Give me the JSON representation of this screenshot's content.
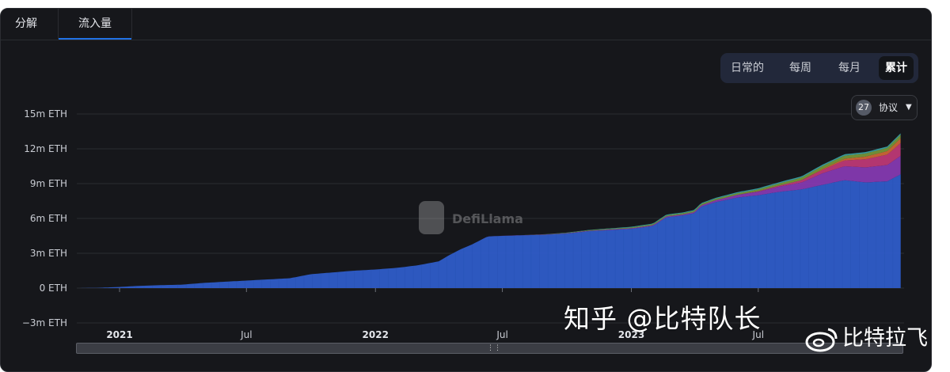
{
  "tabs": [
    {
      "label": "分解",
      "active": false
    },
    {
      "label": "流入量",
      "active": true
    }
  ],
  "period_toggle": {
    "options": [
      "日常的",
      "每周",
      "每月",
      "累计"
    ],
    "selected": "累计"
  },
  "protocol_filter": {
    "count": "27",
    "label": "协议"
  },
  "logo_watermark": "DefiLlama",
  "overlay_watermarks": {
    "zhihu": "知乎 @比特队长",
    "weibo": "比特拉飞"
  },
  "colors": {
    "primary_series": "#2e5cc8",
    "accent_tab": "#2172e5",
    "background": "#16171b"
  },
  "chart_data": {
    "type": "area",
    "title": "",
    "xlabel": "",
    "ylabel": "",
    "y_unit": "m ETH",
    "ylim": [
      -3,
      15
    ],
    "y_ticks": [
      -3,
      0,
      3,
      6,
      9,
      12,
      15
    ],
    "y_tick_labels": [
      "−3m ETH",
      "0 ETH",
      "3m ETH",
      "6m ETH",
      "9m ETH",
      "12m ETH",
      "15m ETH"
    ],
    "xlim": [
      "2020-11-01",
      "2024-01-25"
    ],
    "x_ticks": [
      {
        "date": "2021-01-01",
        "label": "2021",
        "bold": true
      },
      {
        "date": "2021-07-01",
        "label": "Jul",
        "bold": false
      },
      {
        "date": "2022-01-01",
        "label": "2022",
        "bold": true
      },
      {
        "date": "2022-07-01",
        "label": "Jul",
        "bold": false
      },
      {
        "date": "2023-01-01",
        "label": "2023",
        "bold": true
      },
      {
        "date": "2023-07-01",
        "label": "Jul",
        "bold": false
      }
    ],
    "grid": true,
    "legend": "none",
    "stacked": true,
    "series": [
      {
        "color": "#2e5cc8",
        "points": [
          [
            "2020-11-01",
            0
          ],
          [
            "2020-12-01",
            0.02
          ],
          [
            "2021-01-01",
            0.1
          ],
          [
            "2021-02-01",
            0.2
          ],
          [
            "2021-03-01",
            0.25
          ],
          [
            "2021-04-01",
            0.3
          ],
          [
            "2021-05-01",
            0.45
          ],
          [
            "2021-06-01",
            0.55
          ],
          [
            "2021-07-01",
            0.65
          ],
          [
            "2021-08-01",
            0.75
          ],
          [
            "2021-09-01",
            0.85
          ],
          [
            "2021-10-01",
            1.2
          ],
          [
            "2021-11-01",
            1.35
          ],
          [
            "2021-12-01",
            1.5
          ],
          [
            "2022-01-01",
            1.6
          ],
          [
            "2022-02-01",
            1.75
          ],
          [
            "2022-03-01",
            1.95
          ],
          [
            "2022-04-01",
            2.3
          ],
          [
            "2022-04-15",
            2.8
          ],
          [
            "2022-05-01",
            3.3
          ],
          [
            "2022-05-20",
            3.8
          ],
          [
            "2022-06-10",
            4.45
          ],
          [
            "2022-07-01",
            4.5
          ],
          [
            "2022-08-01",
            4.55
          ],
          [
            "2022-09-01",
            4.6
          ],
          [
            "2022-10-01",
            4.7
          ],
          [
            "2022-11-01",
            4.9
          ],
          [
            "2022-12-01",
            5.0
          ],
          [
            "2023-01-01",
            5.1
          ],
          [
            "2023-02-01",
            5.35
          ],
          [
            "2023-02-20",
            6.1
          ],
          [
            "2023-03-15",
            6.25
          ],
          [
            "2023-04-01",
            6.45
          ],
          [
            "2023-04-10",
            7.0
          ],
          [
            "2023-05-01",
            7.4
          ],
          [
            "2023-06-01",
            7.8
          ],
          [
            "2023-07-01",
            8.0
          ],
          [
            "2023-08-01",
            8.3
          ],
          [
            "2023-09-01",
            8.5
          ],
          [
            "2023-10-01",
            8.9
          ],
          [
            "2023-11-01",
            9.3
          ],
          [
            "2023-12-01",
            9.1
          ],
          [
            "2024-01-01",
            9.2
          ],
          [
            "2024-01-20",
            9.8
          ]
        ]
      },
      {
        "color": "#8a3bb8",
        "points": [
          [
            "2020-11-01",
            0
          ],
          [
            "2022-06-01",
            0
          ],
          [
            "2022-12-01",
            0.05
          ],
          [
            "2023-04-01",
            0.1
          ],
          [
            "2023-07-01",
            0.3
          ],
          [
            "2023-09-01",
            0.6
          ],
          [
            "2023-10-01",
            1.0
          ],
          [
            "2023-11-01",
            1.2
          ],
          [
            "2023-12-01",
            1.3
          ],
          [
            "2024-01-01",
            1.4
          ],
          [
            "2024-01-20",
            1.6
          ]
        ]
      },
      {
        "color": "#c43a7a",
        "points": [
          [
            "2020-11-01",
            0
          ],
          [
            "2023-06-01",
            0
          ],
          [
            "2023-08-01",
            0.1
          ],
          [
            "2023-10-01",
            0.3
          ],
          [
            "2023-11-01",
            0.5
          ],
          [
            "2023-12-01",
            0.7
          ],
          [
            "2024-01-01",
            0.9
          ],
          [
            "2024-01-20",
            1.1
          ]
        ]
      },
      {
        "color": "#d46a35",
        "points": [
          [
            "2020-11-01",
            0
          ],
          [
            "2023-09-01",
            0
          ],
          [
            "2023-11-01",
            0.15
          ],
          [
            "2024-01-01",
            0.3
          ],
          [
            "2024-01-20",
            0.4
          ]
        ]
      },
      {
        "color": "#7a9a38",
        "points": [
          [
            "2020-11-01",
            0
          ],
          [
            "2022-08-01",
            0
          ],
          [
            "2023-02-01",
            0.08
          ],
          [
            "2023-07-01",
            0.15
          ],
          [
            "2023-10-01",
            0.25
          ],
          [
            "2024-01-01",
            0.28
          ],
          [
            "2024-01-20",
            0.3
          ]
        ]
      },
      {
        "color": "#3aa6a8",
        "points": [
          [
            "2020-11-01",
            0
          ],
          [
            "2022-08-01",
            0
          ],
          [
            "2023-02-01",
            0.06
          ],
          [
            "2023-07-01",
            0.1
          ],
          [
            "2023-10-01",
            0.12
          ],
          [
            "2024-01-01",
            0.12
          ],
          [
            "2024-01-20",
            0.13
          ]
        ]
      }
    ]
  }
}
